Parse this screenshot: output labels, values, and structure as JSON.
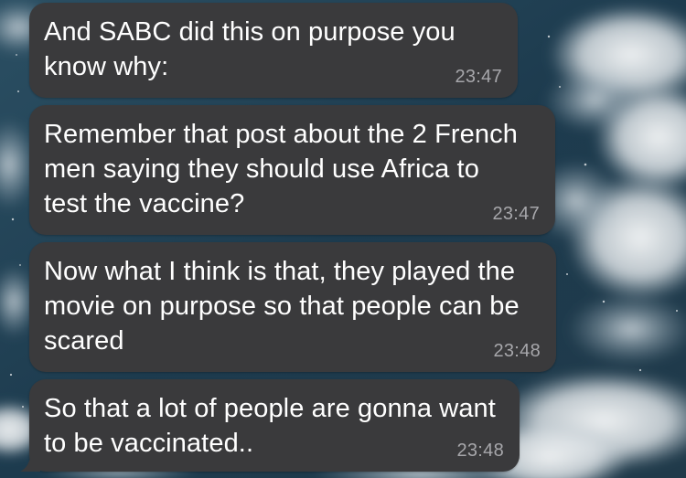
{
  "messages": [
    {
      "text": "And SABC did this on purpose you know why:",
      "time": "23:47"
    },
    {
      "text": "Remember that post about the 2 French men saying they should use Africa to test the vaccine?",
      "time": "23:47"
    },
    {
      "text": "Now what I think is that, they played the movie on purpose so that people can be scared",
      "time": "23:48"
    },
    {
      "text": "So that a lot of people are gonna want to be vaccinated..",
      "time": "23:48"
    }
  ],
  "colors": {
    "bubble": "#3a3a3c",
    "text": "#ffffff",
    "timestamp": "#a7a7ab",
    "sky": "#1f3f52"
  }
}
